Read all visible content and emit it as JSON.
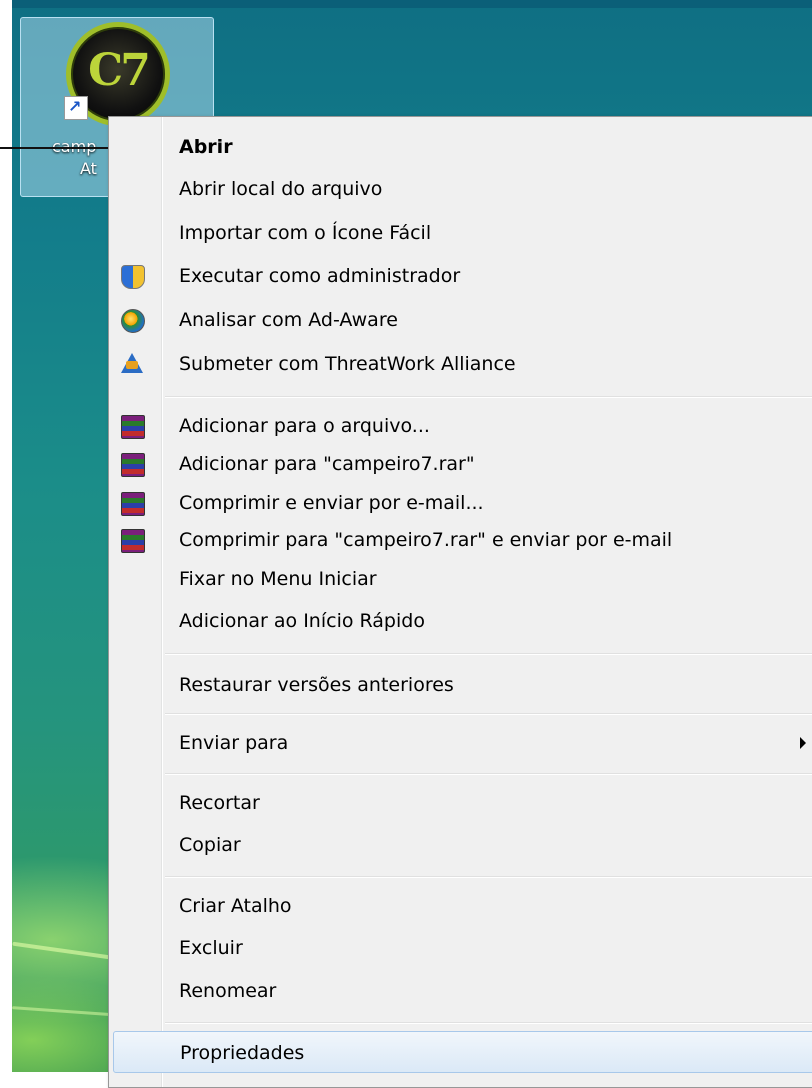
{
  "desktop": {
    "icon": {
      "logo_text": "C7",
      "label_line1": "camp",
      "label_line2": "At"
    }
  },
  "context_menu": {
    "items": [
      {
        "label": "Abrir",
        "bold": true,
        "icon": null
      },
      {
        "label": "Abrir local do arquivo",
        "icon": null
      },
      {
        "label": "Importar com o Ícone Fácil",
        "icon": null
      },
      {
        "label": "Executar como administrador",
        "icon": "uac-shield-icon"
      },
      {
        "label": "Analisar com Ad-Aware",
        "icon": "ad-aware-icon"
      },
      {
        "label": "Submeter com ThreatWork Alliance",
        "icon": "threatwork-icon"
      },
      {
        "label": "Adicionar para o arquivo...",
        "icon": "winrar-icon"
      },
      {
        "label": "Adicionar para \"campeiro7.rar\"",
        "icon": "winrar-icon"
      },
      {
        "label": "Comprimir e enviar por e-mail...",
        "icon": "winrar-icon"
      },
      {
        "label": "Comprimir para \"campeiro7.rar\" e enviar por e-mail",
        "icon": "winrar-icon"
      },
      {
        "label": "Fixar no Menu Iniciar",
        "icon": null
      },
      {
        "label": "Adicionar ao Início Rápido",
        "icon": null
      },
      {
        "label": "Restaurar versões anteriores",
        "icon": null
      },
      {
        "label": "Enviar para",
        "icon": null,
        "submenu": true
      },
      {
        "label": "Recortar",
        "icon": null
      },
      {
        "label": "Copiar",
        "icon": null
      },
      {
        "label": "Criar Atalho",
        "icon": null
      },
      {
        "label": "Excluir",
        "icon": null
      },
      {
        "label": "Renomear",
        "icon": null
      },
      {
        "label": "Propriedades",
        "icon": null,
        "highlighted": true
      }
    ]
  }
}
